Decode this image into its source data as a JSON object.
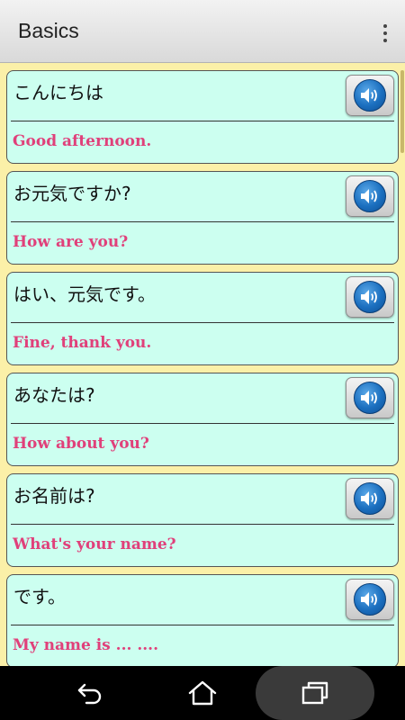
{
  "app_bar": {
    "title": "Basics",
    "menu_icon": "more-vert-icon"
  },
  "phrases": [
    {
      "japanese": "こんにちは",
      "english": "Good afternoon."
    },
    {
      "japanese": "お元気ですか?",
      "english": "How are you?"
    },
    {
      "japanese": "はい、元気です。",
      "english": "Fine, thank you."
    },
    {
      "japanese": "あなたは?",
      "english": "How about you?"
    },
    {
      "japanese": "お名前は?",
      "english": "What's your name?"
    },
    {
      "japanese": "です。",
      "english": "My name is ... ...."
    }
  ],
  "phrase_button_icon": "speaker-icon",
  "navigation": {
    "back_icon": "back-icon",
    "home_icon": "home-icon",
    "recents_icon": "recents-icon"
  },
  "colors": {
    "background": "#fbf0a8",
    "card": "#ccfff0",
    "english_text": "#e0407a",
    "speaker_blue": "#1b6fbf"
  }
}
